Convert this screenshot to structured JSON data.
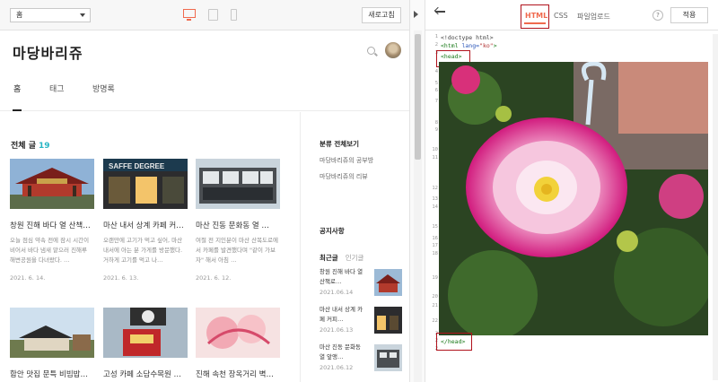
{
  "preview": {
    "page_select": "홈",
    "refresh_label": "새로고침",
    "blog_title": "마당바리쥬",
    "nav": [
      "홈",
      "태그",
      "방명록"
    ],
    "posts_heading": "전체 글",
    "posts_count": "19",
    "posts": [
      {
        "title": "창원 진해 바다 열 산책로…",
        "excerpt": "오늘 점심 약속 전에 잠시 시간이 비어서 바다 냄새 맡으러 진해루 해변공원을 다녀왔다. …",
        "date": "2021. 6. 14."
      },
      {
        "title": "마산 내서 상계 카페 커…",
        "excerpt": "오랜만에 고기가 먹고 싶어, 마산 내서에 아는 분 가게를 방문했다. 거하게 고기를 먹고 나…",
        "date": "2021. 6. 13."
      },
      {
        "title": "마산 진동 문화동 열 …",
        "excerpt": "여절 전 지인분이 마산 산복도로에서 카페를 발견했다며 \"같이 가보자\" 해서 아침 …",
        "date": "2021. 6. 12."
      },
      {
        "title": "함안 맛집 문특 비빔밥…",
        "excerpt": "",
        "date": ""
      },
      {
        "title": "고성 카페 소담수목원 …",
        "excerpt": "",
        "date": ""
      },
      {
        "title": "진해 속천 장옥거리 벽…",
        "excerpt": "",
        "date": ""
      }
    ],
    "sidebar": {
      "category_heading": "분류 전체보기",
      "categories": [
        "마당바리쥬의 공부방",
        "마당바리쥬의 리뷰"
      ],
      "notice_heading": "공지사항",
      "tab_recent": "최근글",
      "tab_popular": "인기글",
      "recent": [
        {
          "title": "창원 진해 바다 열 산책로…",
          "date": "2021.06.14"
        },
        {
          "title": "마산 내서 상계 카페 커피…",
          "date": "2021.06.13"
        },
        {
          "title": "마산 진동 문화동 열 앞앵…",
          "date": "2021.06.12"
        }
      ]
    }
  },
  "editor": {
    "tabs": [
      "HTML",
      "CSS",
      "파일업로드"
    ],
    "active_tab": "HTML",
    "help_label": "?",
    "apply_label": "적용",
    "lines": {
      "l1": "<!doctype html>",
      "l2_open": "<html ",
      "l2_attr": "lang=",
      "l2_val": "\"ko\"",
      "l2_close": ">",
      "l3": "<head>",
      "l_end": "</head>"
    },
    "line_numbers": [
      "1",
      "2",
      "3",
      "4",
      "5",
      "6",
      "7",
      "8",
      "9",
      "10",
      "11",
      "12",
      "13",
      "14",
      "15",
      "16",
      "17",
      "18",
      "19",
      "20",
      "21",
      "22",
      "2",
      "2",
      "2"
    ]
  },
  "colors": {
    "accent": "#f06a4e",
    "highlight_box": "#b0121c",
    "count_teal": "#26b5c4"
  }
}
